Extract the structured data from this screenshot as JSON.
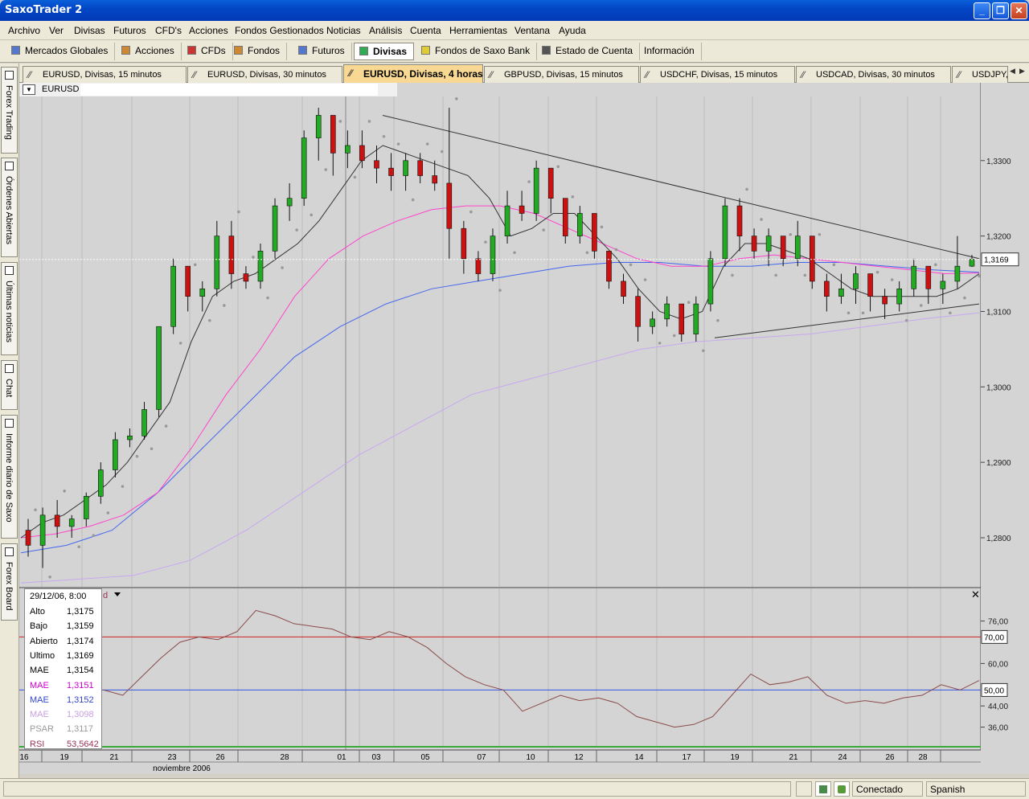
{
  "window": {
    "title": "SaxoTrader 2"
  },
  "menu": [
    "Archivo",
    "Ver",
    "Divisas",
    "Futuros",
    "CFD's",
    "Acciones",
    "Fondos Gestionados",
    "Noticias",
    "Análisis",
    "Cuenta",
    "Herramientas",
    "Ventana",
    "Ayuda"
  ],
  "toolbar": [
    {
      "label": "Mercados Globales",
      "icon": "globe-icon",
      "color": "#5577cc"
    },
    {
      "label": "Acciones",
      "icon": "stocks-icon",
      "color": "#cc8833"
    },
    {
      "label": "CFDs",
      "icon": "cfd-icon",
      "color": "#cc3333"
    },
    {
      "label": "Fondos",
      "icon": "funds-icon",
      "color": "#cc8833"
    },
    {
      "label": "Futuros",
      "icon": "futures-icon",
      "color": "#5577cc"
    },
    {
      "label": "Divisas",
      "icon": "forex-icon",
      "color": "#33aa55",
      "active": true
    },
    {
      "label": "Fondos de Saxo Bank",
      "icon": "saxo-funds-icon",
      "color": "#ddcc33"
    },
    {
      "label": "Estado de Cuenta",
      "icon": "account-statement-icon",
      "color": "#555555"
    },
    {
      "label": "Información",
      "icon": "",
      "color": ""
    }
  ],
  "chart_tabs": [
    "EURUSD, Divisas, 15 minutos",
    "EURUSD, Divisas, 30 minutos",
    "EURUSD, Divisas, 4 horas",
    "GBPUSD, Divisas, 15 minutos",
    "USDCHF, Divisas, 15 minutos",
    "USDCAD, Divisas, 30 minutos",
    "USDJPY, Divisas, 15 minutos"
  ],
  "active_tab": 2,
  "side_tabs": [
    "Forex Trading",
    "Órdenes Abiertas",
    "Últimas noticias",
    "Chat",
    "Informe diario de Saxo",
    "Forex Board"
  ],
  "symbol": "EURUSD",
  "price_axis": {
    "ticks": [
      "1,3300",
      "1,3200",
      "1,3100",
      "1,3000",
      "1,2900",
      "1,2800"
    ],
    "current_label": "1,3169"
  },
  "rsi_axis": {
    "ticks": [
      "76,00",
      "60,00",
      "44,00",
      "36,00"
    ],
    "overbought_label": "70,00",
    "mid_label": "50,00",
    "indicator_letter": "d"
  },
  "date_axis": {
    "labels": [
      "16",
      "19",
      "21",
      "23",
      "26",
      "28",
      "01",
      "03",
      "05",
      "07",
      "10",
      "12",
      "14",
      "17",
      "19",
      "21",
      "24",
      "26",
      "28"
    ],
    "month": "noviembre 2006"
  },
  "info_box": {
    "date": "29/12/06, 8:00",
    "rows": [
      {
        "k": "Alto",
        "v": "1,3175",
        "color": "#000000"
      },
      {
        "k": "Bajo",
        "v": "1,3159",
        "color": "#000000"
      },
      {
        "k": "Abierto",
        "v": "1,3174",
        "color": "#000000"
      },
      {
        "k": "Ultimo",
        "v": "1,3169",
        "color": "#000000"
      },
      {
        "k": "MAE",
        "v": "1,3154",
        "color": "#000000"
      },
      {
        "k": "MAE",
        "v": "1,3151",
        "color": "#cc00cc"
      },
      {
        "k": "MAE",
        "v": "1,3152",
        "color": "#3344cc"
      },
      {
        "k": "MAE",
        "v": "1,3098",
        "color": "#c8a0e0"
      },
      {
        "k": "PSAR",
        "v": "1,3117",
        "color": "#999999"
      },
      {
        "k": "RSI",
        "v": "53,5642",
        "color": "#993355"
      }
    ]
  },
  "status": {
    "connection": "Conectado",
    "language": "Spanish"
  },
  "colors": {
    "up": "#22aa22",
    "down": "#cc1111",
    "ema1": "#333333",
    "ema2": "#ff44cc",
    "ema3": "#4466ee",
    "ema4": "#c8a8f0",
    "psar": "#999999",
    "rsi": "#8a4a4a",
    "ob_line": "#cc2222",
    "mid_line": "#3355dd"
  },
  "chart_data": {
    "type": "candlestick",
    "ohlc_sampled": [
      [
        1.281,
        1.2825,
        1.2775,
        1.279
      ],
      [
        1.279,
        1.284,
        1.276,
        1.283
      ],
      [
        1.283,
        1.285,
        1.28,
        1.2815
      ],
      [
        1.2815,
        1.283,
        1.28,
        1.2825
      ],
      [
        1.2825,
        1.286,
        1.2815,
        1.2855
      ],
      [
        1.2855,
        1.29,
        1.2845,
        1.289
      ],
      [
        1.289,
        1.294,
        1.288,
        1.293
      ],
      [
        1.293,
        1.2945,
        1.292,
        1.2935
      ],
      [
        1.2935,
        1.298,
        1.293,
        1.297
      ],
      [
        1.297,
        1.308,
        1.296,
        1.308
      ],
      [
        1.308,
        1.317,
        1.307,
        1.316
      ],
      [
        1.316,
        1.315,
        1.31,
        1.312
      ],
      [
        1.312,
        1.314,
        1.31,
        1.313
      ],
      [
        1.313,
        1.322,
        1.312,
        1.32
      ],
      [
        1.32,
        1.322,
        1.313,
        1.315
      ],
      [
        1.315,
        1.316,
        1.313,
        1.314
      ],
      [
        1.314,
        1.319,
        1.313,
        1.318
      ],
      [
        1.318,
        1.325,
        1.317,
        1.324
      ],
      [
        1.324,
        1.327,
        1.322,
        1.325
      ],
      [
        1.325,
        1.334,
        1.324,
        1.333
      ],
      [
        1.333,
        1.337,
        1.33,
        1.336
      ],
      [
        1.336,
        1.334,
        1.328,
        1.331
      ],
      [
        1.331,
        1.334,
        1.329,
        1.332
      ],
      [
        1.332,
        1.334,
        1.329,
        1.33
      ],
      [
        1.33,
        1.332,
        1.327,
        1.329
      ],
      [
        1.329,
        1.331,
        1.326,
        1.328
      ],
      [
        1.328,
        1.331,
        1.326,
        1.33
      ],
      [
        1.33,
        1.331,
        1.327,
        1.328
      ],
      [
        1.328,
        1.33,
        1.326,
        1.327
      ],
      [
        1.327,
        1.337,
        1.317,
        1.321
      ],
      [
        1.321,
        1.322,
        1.315,
        1.317
      ],
      [
        1.317,
        1.318,
        1.314,
        1.315
      ],
      [
        1.315,
        1.321,
        1.314,
        1.32
      ],
      [
        1.32,
        1.326,
        1.319,
        1.324
      ],
      [
        1.324,
        1.326,
        1.322,
        1.323
      ],
      [
        1.323,
        1.33,
        1.322,
        1.329
      ],
      [
        1.329,
        1.328,
        1.323,
        1.325
      ],
      [
        1.325,
        1.324,
        1.319,
        1.32
      ],
      [
        1.32,
        1.324,
        1.319,
        1.323
      ],
      [
        1.323,
        1.32,
        1.317,
        1.318
      ],
      [
        1.318,
        1.317,
        1.313,
        1.314
      ],
      [
        1.314,
        1.315,
        1.311,
        1.312
      ],
      [
        1.312,
        1.313,
        1.306,
        1.308
      ],
      [
        1.308,
        1.31,
        1.307,
        1.309
      ],
      [
        1.309,
        1.312,
        1.308,
        1.311
      ],
      [
        1.311,
        1.31,
        1.306,
        1.307
      ],
      [
        1.307,
        1.312,
        1.306,
        1.311
      ],
      [
        1.311,
        1.318,
        1.31,
        1.317
      ],
      [
        1.317,
        1.325,
        1.316,
        1.324
      ],
      [
        1.324,
        1.325,
        1.318,
        1.32
      ],
      [
        1.32,
        1.321,
        1.317,
        1.318
      ],
      [
        1.318,
        1.321,
        1.316,
        1.32
      ],
      [
        1.32,
        1.319,
        1.316,
        1.317
      ],
      [
        1.317,
        1.322,
        1.316,
        1.32
      ],
      [
        1.32,
        1.319,
        1.313,
        1.314
      ],
      [
        1.314,
        1.315,
        1.31,
        1.312
      ],
      [
        1.312,
        1.315,
        1.311,
        1.313
      ],
      [
        1.313,
        1.316,
        1.311,
        1.315
      ],
      [
        1.315,
        1.314,
        1.31,
        1.312
      ],
      [
        1.312,
        1.313,
        1.309,
        1.311
      ],
      [
        1.311,
        1.314,
        1.31,
        1.313
      ],
      [
        1.313,
        1.317,
        1.312,
        1.316
      ],
      [
        1.316,
        1.315,
        1.311,
        1.313
      ],
      [
        1.313,
        1.315,
        1.311,
        1.314
      ],
      [
        1.314,
        1.32,
        1.313,
        1.316
      ],
      [
        1.316,
        1.3175,
        1.3159,
        1.3169
      ]
    ],
    "ema1": [
      1.28,
      1.282,
      1.283,
      1.285,
      1.287,
      1.29,
      1.294,
      1.298,
      1.306,
      1.312,
      1.314,
      1.315,
      1.317,
      1.319,
      1.322,
      1.326,
      1.33,
      1.332,
      1.331,
      1.33,
      1.329,
      1.328,
      1.325,
      1.32,
      1.321,
      1.323,
      1.323,
      1.32,
      1.317,
      1.313,
      1.31,
      1.309,
      1.31,
      1.316,
      1.319,
      1.319,
      1.318,
      1.317,
      1.315,
      1.313,
      1.312,
      1.312,
      1.312,
      1.312,
      1.313,
      1.315
    ],
    "ema2": [
      1.28,
      1.2805,
      1.2815,
      1.283,
      1.286,
      1.292,
      1.299,
      1.305,
      1.312,
      1.317,
      1.32,
      1.322,
      1.3235,
      1.324,
      1.324,
      1.323,
      1.321,
      1.319,
      1.317,
      1.316,
      1.316,
      1.317,
      1.3175,
      1.317,
      1.3165,
      1.316,
      1.3155,
      1.315,
      1.3151
    ],
    "ema3": [
      1.278,
      1.279,
      1.281,
      1.286,
      1.292,
      1.298,
      1.304,
      1.308,
      1.311,
      1.313,
      1.314,
      1.315,
      1.316,
      1.3165,
      1.3165,
      1.316,
      1.316,
      1.3165,
      1.3165,
      1.316,
      1.3155,
      1.3152
    ],
    "ema4": [
      1.274,
      1.2745,
      1.275,
      1.277,
      1.281,
      1.286,
      1.291,
      1.295,
      1.299,
      1.301,
      1.303,
      1.305,
      1.306,
      1.3065,
      1.307,
      1.308,
      1.309,
      1.3098
    ],
    "rsi": [
      50,
      48,
      55,
      62,
      68,
      70,
      69,
      72,
      80,
      78,
      75,
      74,
      73,
      70,
      69,
      72,
      70,
      66,
      60,
      55,
      52,
      50,
      42,
      45,
      48,
      46,
      47,
      45,
      40,
      38,
      36,
      37,
      40,
      48,
      56,
      52,
      53,
      55,
      48,
      45,
      46,
      45,
      47,
      48,
      52,
      50,
      53.5642
    ],
    "trendlines": [
      {
        "from": [
          1.336
        ],
        "to": [
          1.317
        ]
      },
      {
        "from": [
          1.3065
        ],
        "to": [
          1.311
        ]
      }
    ]
  }
}
